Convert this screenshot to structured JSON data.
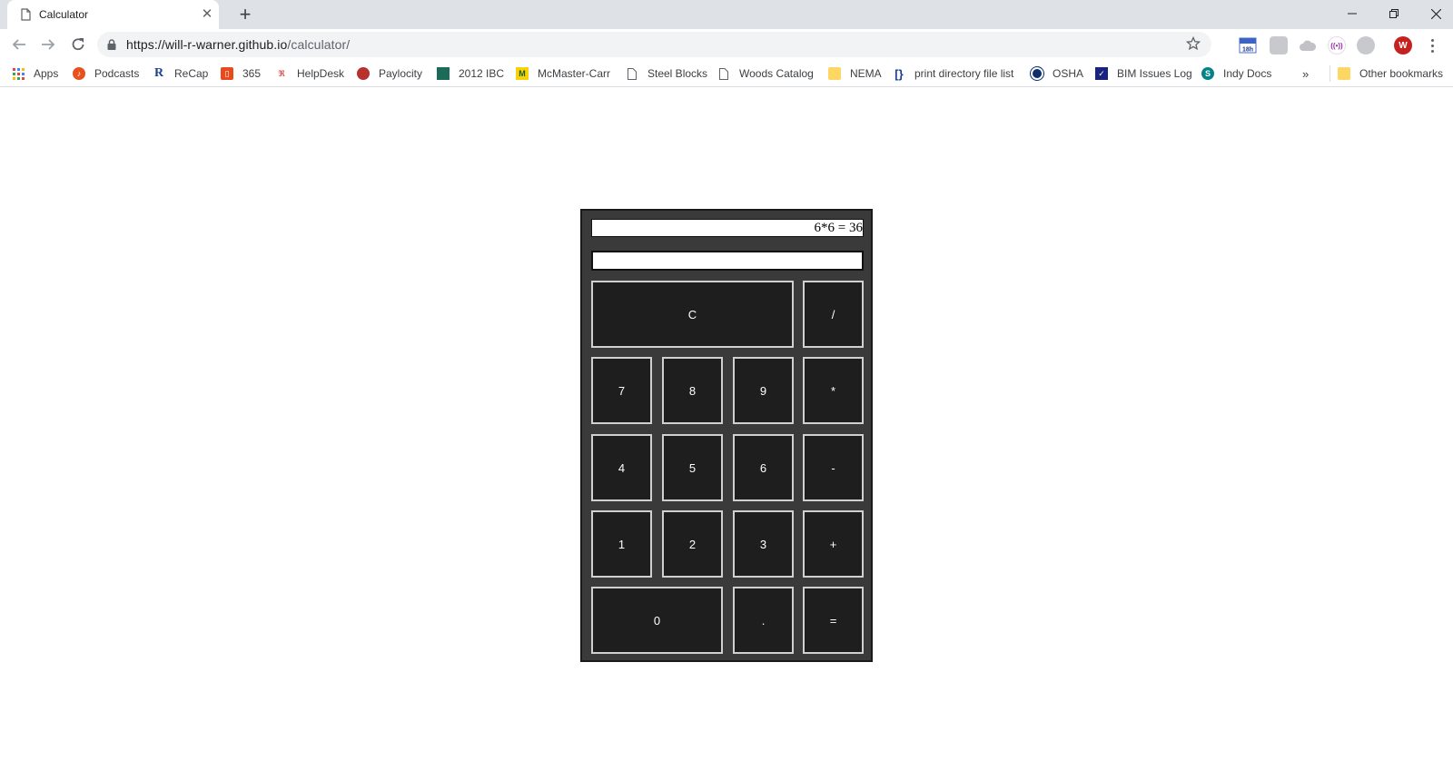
{
  "browser": {
    "tab_title": "Calculator",
    "url_host": "https://will-r-warner.github.io",
    "url_path": "/calculator/",
    "profile_initial": "W"
  },
  "bookmarks": {
    "items": [
      {
        "label": "Apps",
        "icon": "apps-grid-icon"
      },
      {
        "label": "Podcasts",
        "icon": "podcasts-icon"
      },
      {
        "label": "ReCap",
        "icon": "recap-icon"
      },
      {
        "label": "365",
        "icon": "office-365-icon"
      },
      {
        "label": "HelpDesk",
        "icon": "helpdesk-icon"
      },
      {
        "label": "Paylocity",
        "icon": "paylocity-icon"
      },
      {
        "label": "2012 IBC",
        "icon": "ibc-icon"
      },
      {
        "label": "McMaster-Carr",
        "icon": "mcmaster-icon"
      },
      {
        "label": "Steel Blocks",
        "icon": "page-icon"
      },
      {
        "label": "Woods Catalog",
        "icon": "page-icon"
      },
      {
        "label": "NEMA",
        "icon": "folder-icon"
      },
      {
        "label": "print directory file list",
        "icon": "script-icon"
      },
      {
        "label": "OSHA",
        "icon": "osha-icon"
      },
      {
        "label": "BIM Issues Log",
        "icon": "bim-icon"
      },
      {
        "label": "Indy Docs",
        "icon": "sharepoint-icon"
      }
    ],
    "overflow": "»",
    "other": "Other bookmarks"
  },
  "calculator": {
    "history": "6*6 = 36",
    "input": "",
    "keys": {
      "clear": "C",
      "divide": "/",
      "seven": "7",
      "eight": "8",
      "nine": "9",
      "multiply": "*",
      "four": "4",
      "five": "5",
      "six": "6",
      "subtract": "-",
      "one": "1",
      "two": "2",
      "three": "3",
      "add": "+",
      "zero": "0",
      "decimal": ".",
      "equals": "="
    }
  }
}
